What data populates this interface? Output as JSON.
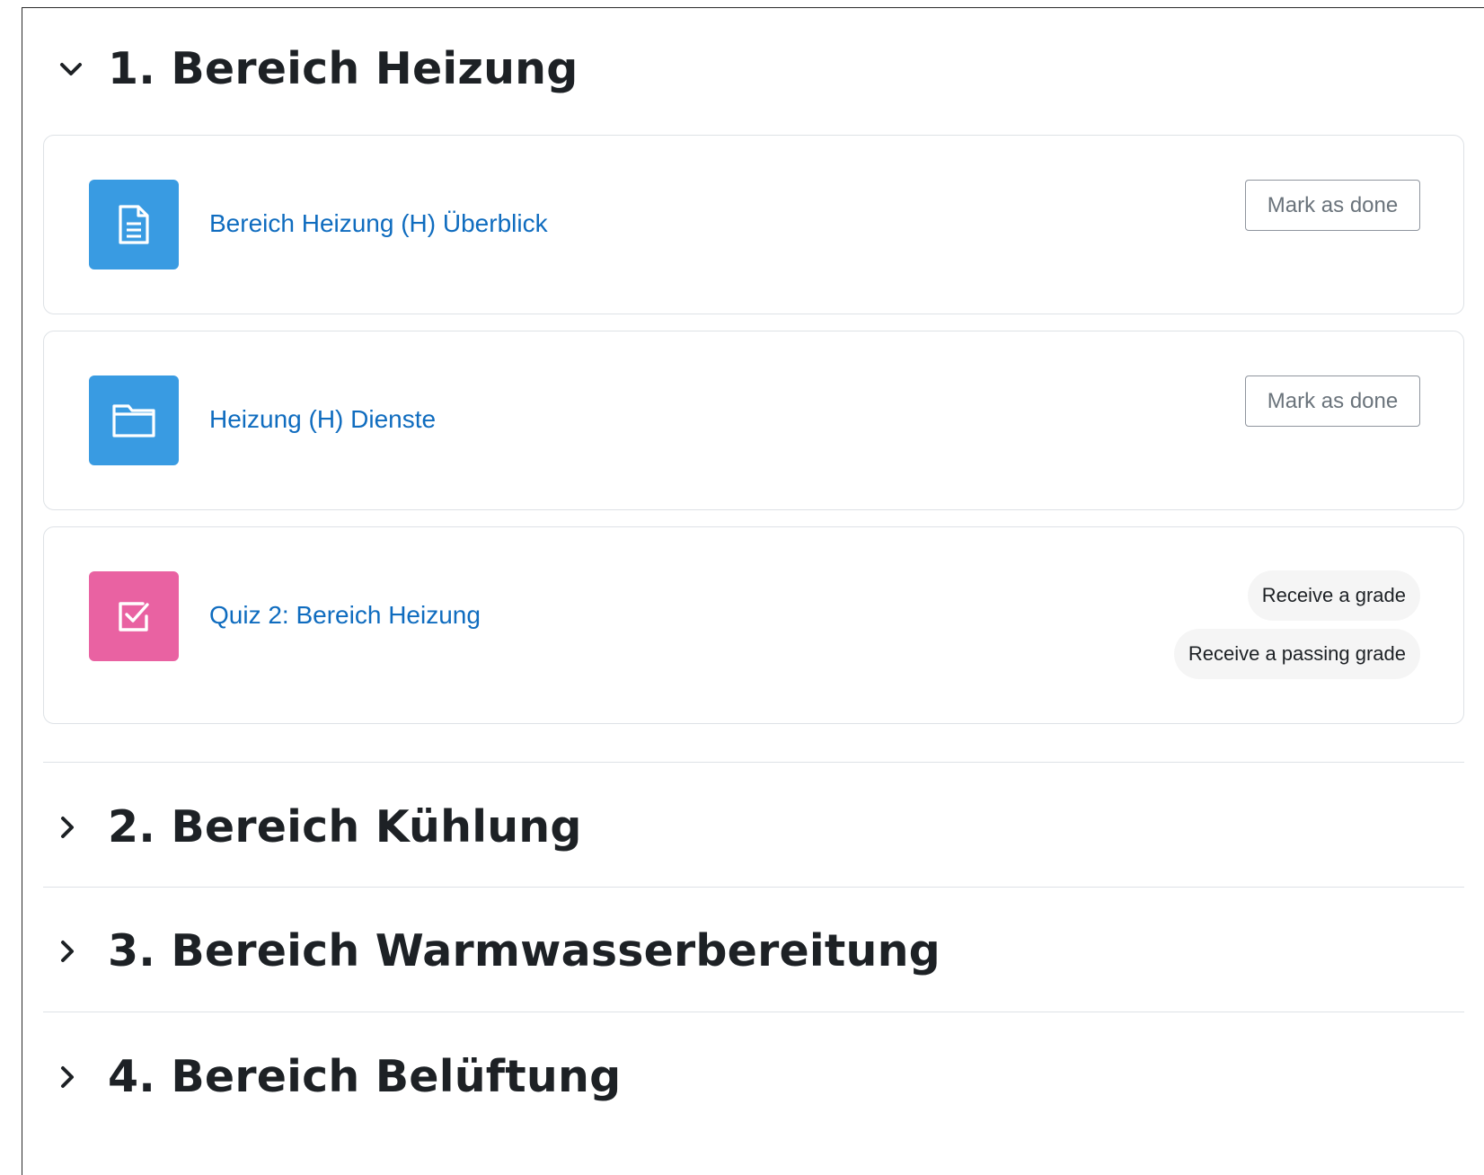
{
  "colors": {
    "link": "#0f6cbf",
    "resource_icon_bg": "#399be2",
    "quiz_icon_bg": "#e962a2",
    "card_border": "#dee2e6",
    "badge_bg": "#f5f5f5"
  },
  "sections": [
    {
      "title": "1. Bereich Heizung",
      "state": "expanded",
      "icon": "chevron-down-icon",
      "activities": [
        {
          "name": "Bereich Heizung (H) Überblick",
          "icon": "page-icon",
          "completion": {
            "type": "button",
            "label": "Mark as done"
          }
        },
        {
          "name": "Heizung (H) Dienste",
          "icon": "folder-icon",
          "completion": {
            "type": "button",
            "label": "Mark as done"
          }
        },
        {
          "name": "Quiz 2: Bereich Heizung",
          "icon": "quiz-icon",
          "completion": {
            "type": "badges",
            "labels": [
              "Receive a grade",
              "Receive a passing grade"
            ]
          }
        }
      ]
    },
    {
      "title": "2. Bereich Kühlung",
      "state": "collapsed",
      "icon": "chevron-right-icon"
    },
    {
      "title": "3. Bereich Warmwasserbereitung",
      "state": "collapsed",
      "icon": "chevron-right-icon"
    },
    {
      "title": "4. Bereich Belüftung",
      "state": "collapsed",
      "icon": "chevron-right-icon"
    }
  ]
}
